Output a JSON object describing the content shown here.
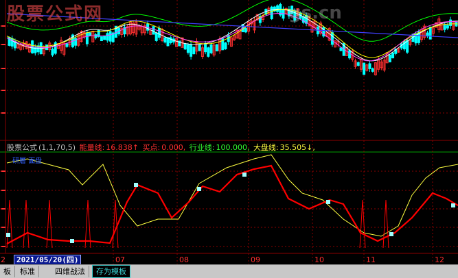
{
  "watermark": {
    "left": "股票公式网",
    "right": "gs.cn"
  },
  "formula": {
    "name": "股票公式",
    "params": "(1,1,70,5)",
    "energy_label": "能量线:",
    "energy_value": "16.838↑",
    "buy_label": "买点:",
    "buy_value": "0.000,",
    "industry_label": "行业线:",
    "industry_value": "100.000,",
    "market_label": "大盘线:",
    "market_value": "35.505↓,"
  },
  "legend": {
    "a": "研層",
    "b": "面盘"
  },
  "date_box": "2021/05/20(四)",
  "left_digit": "2",
  "axis": {
    "months": [
      "07",
      "08",
      "09",
      "10",
      "11",
      "12"
    ]
  },
  "tabs": [
    {
      "label": "板",
      "active": false
    },
    {
      "label": "标准",
      "active": false
    },
    {
      "label": "四维战法",
      "active": false
    },
    {
      "label": "存为模板",
      "active": true
    }
  ],
  "colors": {
    "background": "#000000",
    "up": "#ff3030",
    "down": "#00ffff",
    "grid": "#8b0000",
    "energy": "#ff0000",
    "market": "#ffff40",
    "ma_white": "#ffffff",
    "ma_yellow": "#ffff00",
    "ma_magenta": "#ff40ff",
    "ma_green": "#00ff00",
    "ma_blue": "#4040ff"
  }
}
